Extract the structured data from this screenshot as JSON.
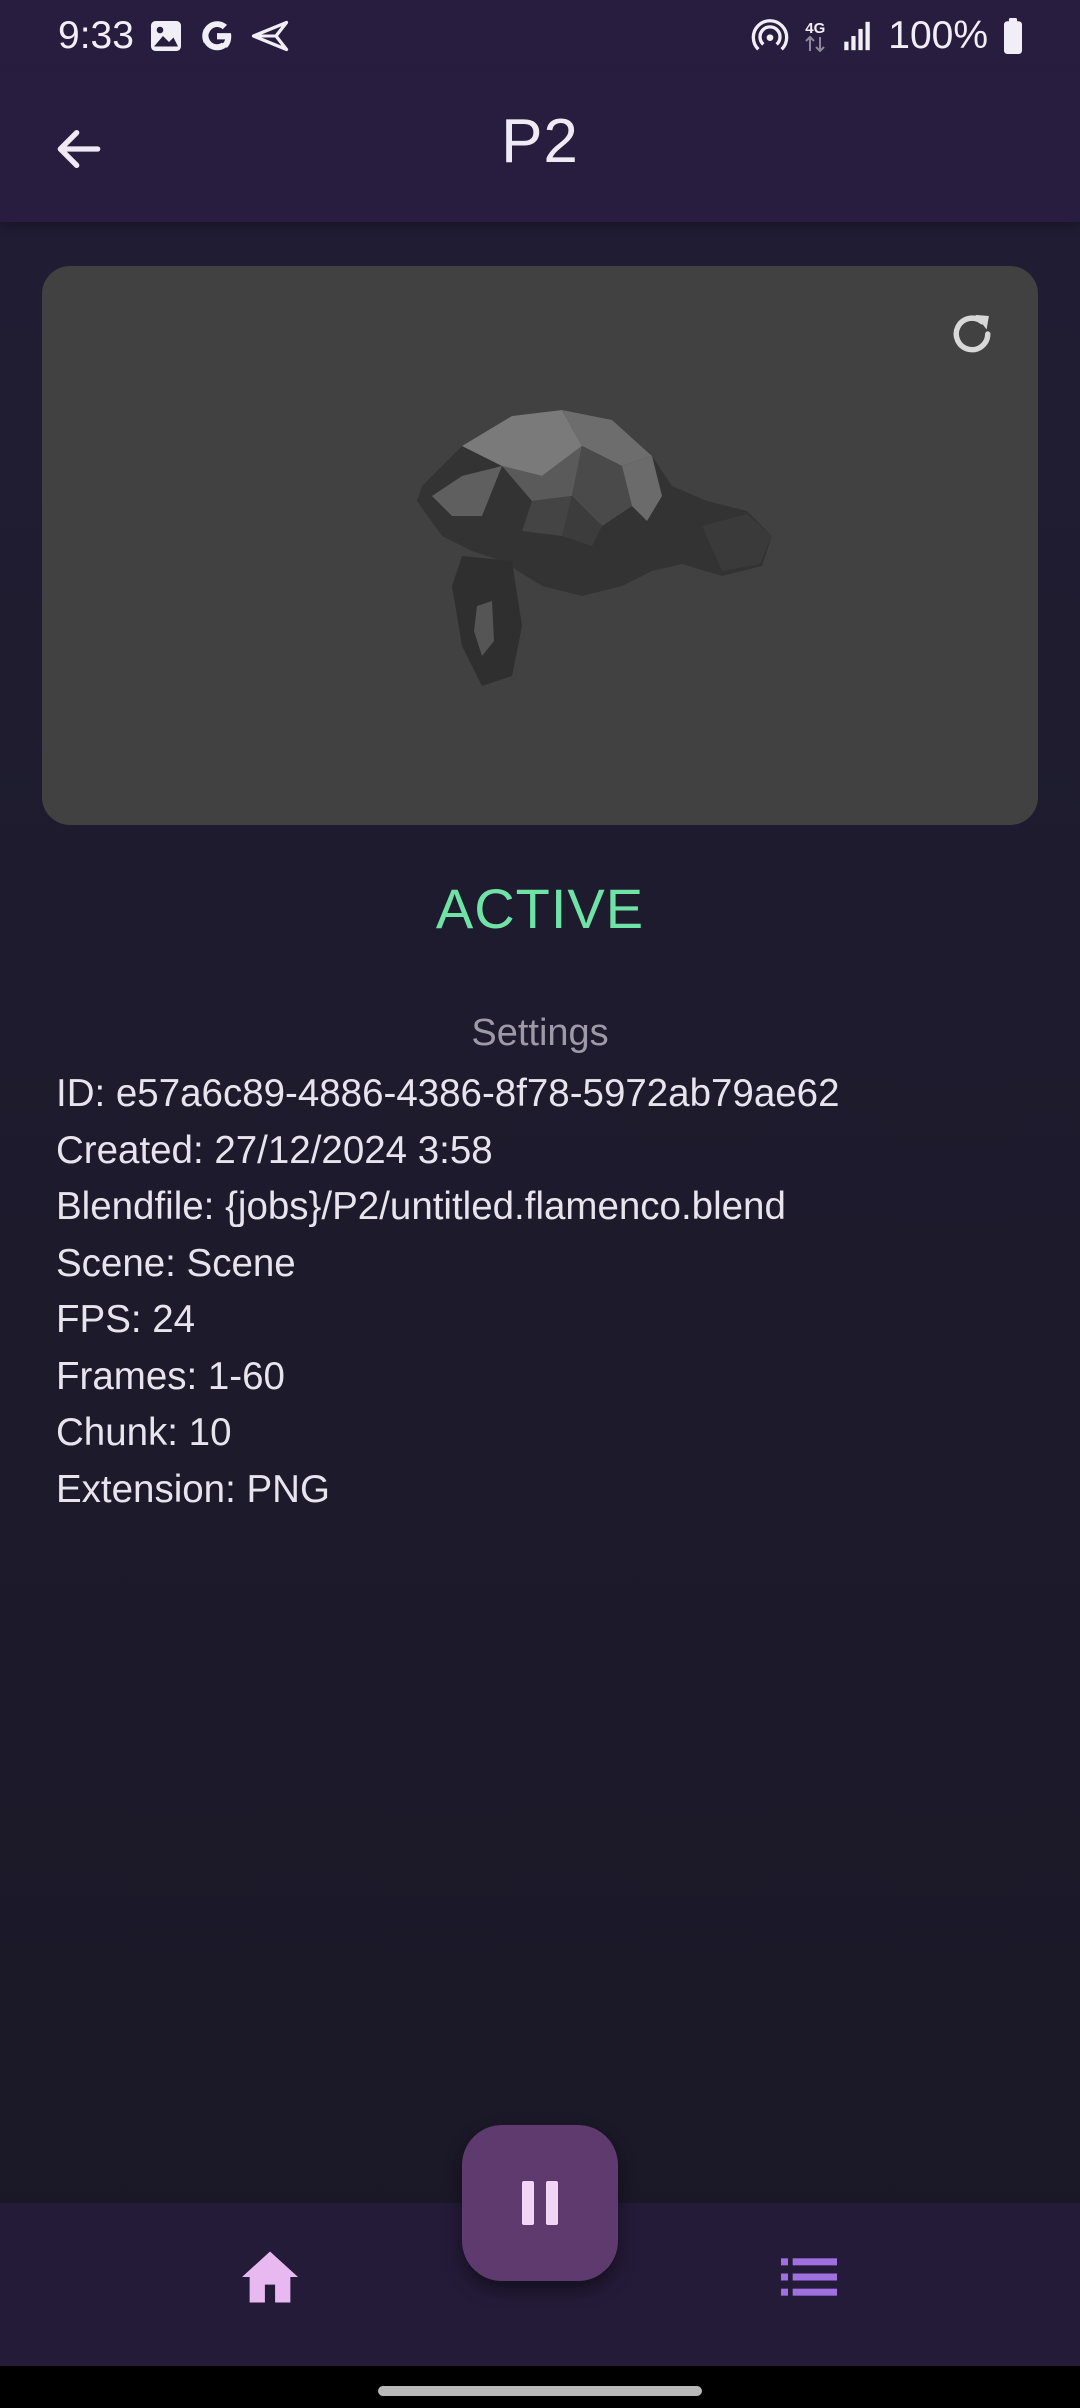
{
  "status_bar": {
    "time": "9:33",
    "left_icons": [
      "image-icon",
      "google-icon",
      "send-icon"
    ],
    "right_icons": [
      "hotspot-icon",
      "network-4g-icon",
      "signal-icon",
      "battery-icon"
    ],
    "network_label": "4G",
    "battery": "100%"
  },
  "app_bar": {
    "title": "P2",
    "back_icon": "arrow-back-icon"
  },
  "preview": {
    "refresh_icon": "refresh-icon",
    "image_alt": "Rendered frame of low-poly monkey head"
  },
  "job": {
    "status": "ACTIVE",
    "status_color": "#6fe3a6"
  },
  "settings": {
    "title": "Settings",
    "lines": [
      "ID: e57a6c89-4886-4386-8f78-5972ab79ae62",
      "Created: 27/12/2024 3:58",
      "Blendfile: {jobs}/P2/untitled.flamenco.blend",
      "Scene: Scene",
      "FPS: 24",
      "Frames: 1-60",
      "Chunk: 10",
      "Extension: PNG"
    ]
  },
  "bottom_nav": {
    "items": [
      {
        "icon": "home-icon",
        "active": true
      },
      {
        "icon": "list-icon",
        "active": false
      }
    ],
    "fab_icon": "pause-icon"
  },
  "colors": {
    "app_bar_bg": "#291d3f",
    "fab_bg": "#5e3a6e",
    "accent_home": "#e8b8f0",
    "accent_list": "#a070e0"
  }
}
